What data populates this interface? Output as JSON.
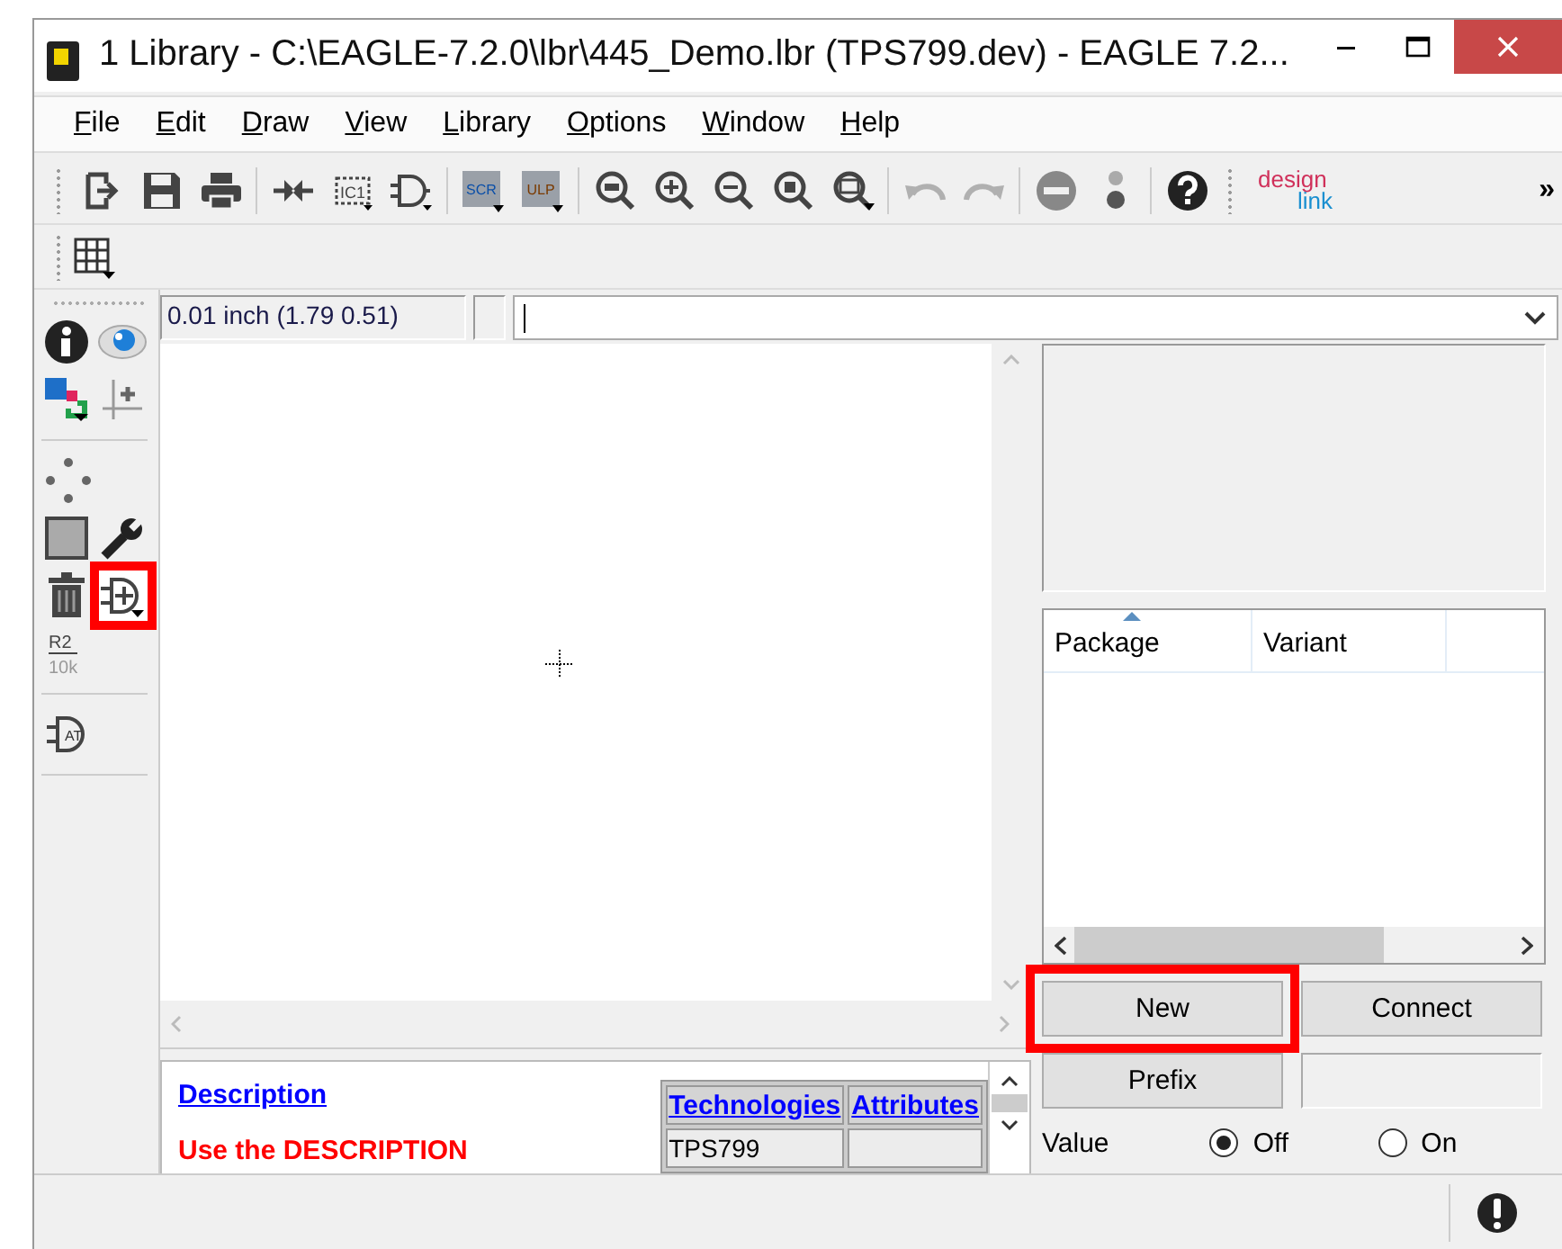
{
  "window": {
    "title": "1 Library - C:\\EAGLE-7.2.0\\lbr\\445_Demo.lbr (TPS799.dev) - EAGLE 7.2..."
  },
  "menu": [
    "File",
    "Edit",
    "Draw",
    "View",
    "Library",
    "Options",
    "Window",
    "Help"
  ],
  "toolbar": {
    "items": [
      {
        "kind": "export"
      },
      {
        "kind": "save"
      },
      {
        "kind": "print"
      },
      {
        "kind": "sep"
      },
      {
        "kind": "connect"
      },
      {
        "kind": "package",
        "label": "IC1"
      },
      {
        "kind": "symbol"
      },
      {
        "kind": "sep"
      },
      {
        "kind": "script",
        "label": "SCR"
      },
      {
        "kind": "ulp",
        "label": "ULP"
      },
      {
        "kind": "sep"
      },
      {
        "kind": "zoom-fit"
      },
      {
        "kind": "zoom-in"
      },
      {
        "kind": "zoom-out"
      },
      {
        "kind": "zoom-select"
      },
      {
        "kind": "zoom-area"
      },
      {
        "kind": "sep"
      },
      {
        "kind": "undo"
      },
      {
        "kind": "redo"
      },
      {
        "kind": "sep"
      },
      {
        "kind": "stop"
      },
      {
        "kind": "go"
      },
      {
        "kind": "sep"
      },
      {
        "kind": "help"
      }
    ],
    "brand": {
      "top": "design",
      "bottom": "link"
    },
    "overflow": "»"
  },
  "side_toolbar": {
    "groups": [
      {
        "rows": [
          [
            {
              "kind": "info",
              "highlighted": false
            },
            {
              "kind": "eye",
              "highlighted": false
            }
          ],
          [
            {
              "kind": "layers",
              "highlighted": false
            },
            {
              "kind": "origin",
              "highlighted": false
            }
          ]
        ]
      },
      {
        "rows": [
          [
            {
              "kind": "move",
              "highlighted": false
            }
          ],
          [
            {
              "kind": "rect",
              "highlighted": false
            },
            {
              "kind": "wrench",
              "highlighted": false
            }
          ],
          [
            {
              "kind": "delete",
              "highlighted": false
            },
            {
              "kind": "add-gate",
              "highlighted": true
            }
          ],
          [
            {
              "kind": "value",
              "label": "R2",
              "sublabel": "10k",
              "highlighted": false
            }
          ]
        ]
      },
      {
        "rows": [
          [
            {
              "kind": "gate-name",
              "label": "AT",
              "highlighted": false
            }
          ]
        ]
      }
    ]
  },
  "coordinates": "0.01 inch (1.79 0.51)",
  "package_list": {
    "columns": [
      {
        "label": "Package",
        "sorted": true
      },
      {
        "label": "Variant",
        "sorted": false
      }
    ]
  },
  "buttons": [
    {
      "label": "New",
      "highlighted": true
    },
    {
      "label": "Connect",
      "highlighted": false
    }
  ],
  "prefix": {
    "label": "Prefix"
  },
  "value": {
    "label": "Value",
    "options": [
      {
        "label": "Off",
        "selected": true
      },
      {
        "label": "On",
        "selected": false
      }
    ]
  },
  "description": {
    "heading": "Description",
    "text": "Use the DESCRIPTION",
    "table": {
      "columns": [
        "Technologies",
        "Attributes"
      ],
      "rows": [
        [
          "TPS799"
        ]
      ]
    }
  }
}
